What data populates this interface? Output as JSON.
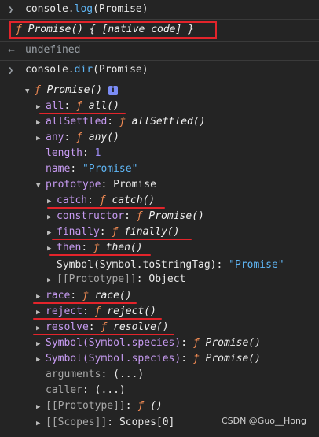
{
  "console": {
    "line1": {
      "prefix": "console.",
      "method": "log",
      "arg": "(Promise)"
    },
    "output1": {
      "f": "ƒ",
      "text": " Promise() { [native code] }"
    },
    "undefined_text": "undefined",
    "line2": {
      "prefix": "console.",
      "method": "dir",
      "arg": "(Promise)"
    }
  },
  "tree": {
    "root_f": "ƒ",
    "root_name": "Promise()",
    "info_char": "i",
    "items": [
      {
        "key": "all",
        "f": "ƒ",
        "val": "all()"
      },
      {
        "key": "allSettled",
        "f": "ƒ",
        "val": "allSettled()"
      },
      {
        "key": "any",
        "f": "ƒ",
        "val": "any()"
      },
      {
        "key": "length",
        "val": "1"
      },
      {
        "key": "name",
        "val": "\"Promise\""
      },
      {
        "key": "prototype",
        "val": "Promise"
      },
      {
        "key": "catch",
        "f": "ƒ",
        "val": "catch()"
      },
      {
        "key": "constructor",
        "f": "ƒ",
        "val": "Promise()"
      },
      {
        "key": "finally",
        "f": "ƒ",
        "val": "finally()"
      },
      {
        "key": "then",
        "f": "ƒ",
        "val": "then()"
      },
      {
        "key": "Symbol(Symbol.toStringTag)",
        "val": "\"Promise\""
      },
      {
        "key": "[[Prototype]]",
        "val": "Object"
      },
      {
        "key": "race",
        "f": "ƒ",
        "val": "race()"
      },
      {
        "key": "reject",
        "f": "ƒ",
        "val": "reject()"
      },
      {
        "key": "resolve",
        "f": "ƒ",
        "val": "resolve()"
      },
      {
        "key": "Symbol(Symbol.species)",
        "f": "ƒ",
        "val": "Promise()"
      },
      {
        "key": "Symbol(Symbol.species)",
        "f": "ƒ",
        "val": "Promise()"
      },
      {
        "key": "arguments",
        "val": "(...)"
      },
      {
        "key": "caller",
        "val": "(...)"
      },
      {
        "key": "[[Prototype]]",
        "f": "ƒ",
        "val": "()"
      },
      {
        "key": "[[Scopes]]",
        "val": "Scopes[0]"
      }
    ]
  },
  "watermark": "CSDN @Guo__Hong",
  "colors": {
    "background": "#242424",
    "key": "#c79bf2",
    "string": "#5fb6f5",
    "number": "#9e8cf5",
    "highlight": "#e3242b"
  }
}
